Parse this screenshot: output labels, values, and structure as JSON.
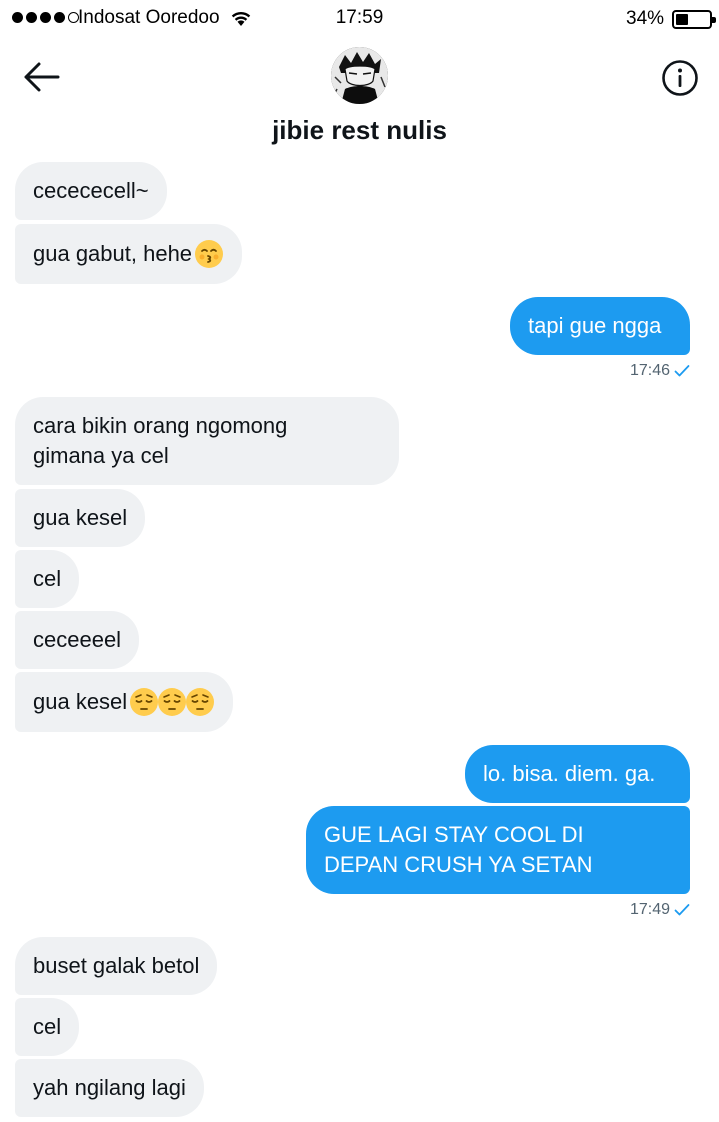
{
  "status_bar": {
    "carrier": "Indosat Ooredoo",
    "time": "17:59",
    "battery": "34%"
  },
  "header": {
    "contact_name": "jibie rest nulis"
  },
  "messages": [
    {
      "text": "cecececell~",
      "direction": "in"
    },
    {
      "text": "gua gabut, hehe",
      "direction": "in",
      "emoji": "kissing-face"
    },
    {
      "text": "tapi gue ngga",
      "direction": "out"
    },
    {
      "text": "cara bikin orang ngomong\ngimana ya cel",
      "direction": "in"
    },
    {
      "text": "gua kesel",
      "direction": "in"
    },
    {
      "text": "cel",
      "direction": "in"
    },
    {
      "text": "ceceeeel",
      "direction": "in"
    },
    {
      "text": "gua kesel ",
      "direction": "in",
      "emoji": "pensive-face x3"
    },
    {
      "text": "lo. bisa. diem. ga.",
      "direction": "out"
    },
    {
      "text": "GUE LAGI STAY COOL DI\nDEPAN CRUSH YA SETAN",
      "direction": "out"
    },
    {
      "text": "buset galak betol",
      "direction": "in"
    },
    {
      "text": "cel",
      "direction": "in"
    },
    {
      "text": "yah ngilang lagi",
      "direction": "in"
    }
  ],
  "timestamps": [
    "17:46",
    "17:49"
  ],
  "colors": {
    "outgoing_bubble": "#1d9bf0",
    "incoming_bubble": "#eff1f3",
    "timestamp": "#536471",
    "emoji_yellow": "#ffcc4d"
  }
}
